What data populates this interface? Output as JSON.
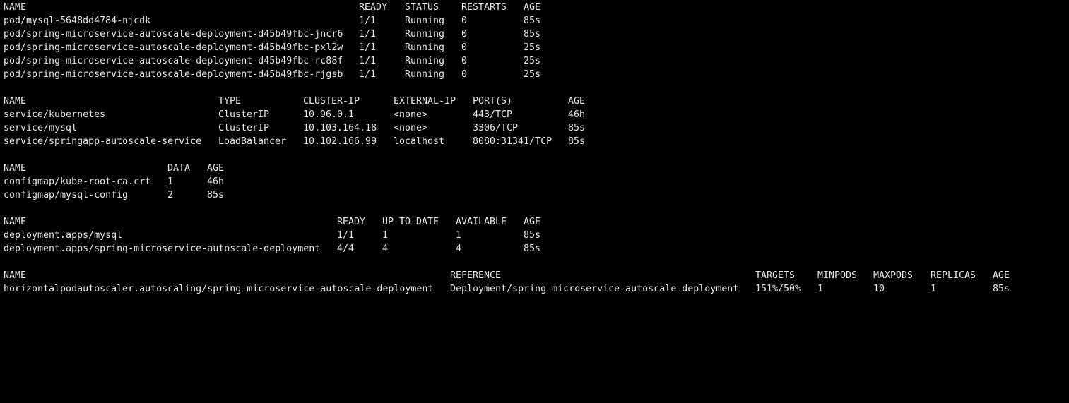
{
  "pods": {
    "headers": [
      "NAME",
      "READY",
      "STATUS",
      "RESTARTS",
      "AGE"
    ],
    "rows": [
      [
        "pod/mysql-5648dd4784-njcdk",
        "1/1",
        "Running",
        "0",
        "85s"
      ],
      [
        "pod/spring-microservice-autoscale-deployment-d45b49fbc-jncr6",
        "1/1",
        "Running",
        "0",
        "85s"
      ],
      [
        "pod/spring-microservice-autoscale-deployment-d45b49fbc-pxl2w",
        "1/1",
        "Running",
        "0",
        "25s"
      ],
      [
        "pod/spring-microservice-autoscale-deployment-d45b49fbc-rc88f",
        "1/1",
        "Running",
        "0",
        "25s"
      ],
      [
        "pod/spring-microservice-autoscale-deployment-d45b49fbc-rjgsb",
        "1/1",
        "Running",
        "0",
        "25s"
      ]
    ]
  },
  "services": {
    "headers": [
      "NAME",
      "TYPE",
      "CLUSTER-IP",
      "EXTERNAL-IP",
      "PORT(S)",
      "AGE"
    ],
    "rows": [
      [
        "service/kubernetes",
        "ClusterIP",
        "10.96.0.1",
        "<none>",
        "443/TCP",
        "46h"
      ],
      [
        "service/mysql",
        "ClusterIP",
        "10.103.164.18",
        "<none>",
        "3306/TCP",
        "85s"
      ],
      [
        "service/springapp-autoscale-service",
        "LoadBalancer",
        "10.102.166.99",
        "localhost",
        "8080:31341/TCP",
        "85s"
      ]
    ]
  },
  "configmaps": {
    "headers": [
      "NAME",
      "DATA",
      "AGE"
    ],
    "rows": [
      [
        "configmap/kube-root-ca.crt",
        "1",
        "46h"
      ],
      [
        "configmap/mysql-config",
        "2",
        "85s"
      ]
    ]
  },
  "deployments": {
    "headers": [
      "NAME",
      "READY",
      "UP-TO-DATE",
      "AVAILABLE",
      "AGE"
    ],
    "rows": [
      [
        "deployment.apps/mysql",
        "1/1",
        "1",
        "1",
        "85s"
      ],
      [
        "deployment.apps/spring-microservice-autoscale-deployment",
        "4/4",
        "4",
        "4",
        "85s"
      ]
    ]
  },
  "hpa": {
    "headers": [
      "NAME",
      "REFERENCE",
      "TARGETS",
      "MINPODS",
      "MAXPODS",
      "REPLICAS",
      "AGE"
    ],
    "rows": [
      [
        "horizontalpodautoscaler.autoscaling/spring-microservice-autoscale-deployment",
        "Deployment/spring-microservice-autoscale-deployment",
        "151%/50%",
        "1",
        "10",
        "1",
        "85s"
      ]
    ]
  }
}
